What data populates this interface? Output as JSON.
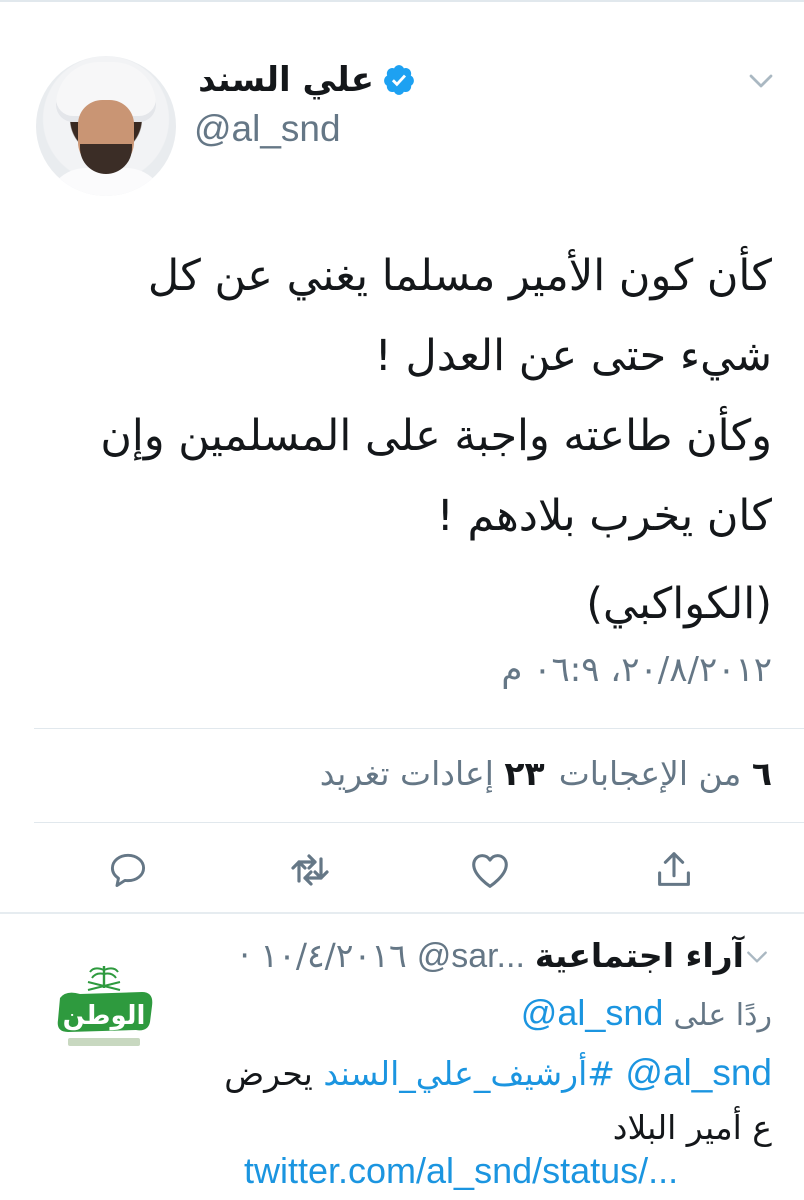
{
  "tweet": {
    "author_name": "علي السند",
    "handle": "@al_snd",
    "text_lines": [
      "كأن كون الأمير مسلما يغني عن كل",
      "شيء حتى عن العدل !",
      "وكأن طاعته واجبة على المسلمين وإن",
      "كان يخرب بلادهم !"
    ],
    "signature": "(الكواكبي)",
    "timestamp": "٢٠/٨/٢٠١٢، ٠٦:٩ م",
    "stats": {
      "likes_count": "٦",
      "likes_label": "من الإعجابات",
      "retweets_count": "٢٣",
      "retweets_label": "إعادات تغريد"
    }
  },
  "actions": {
    "reply_icon": "reply-icon",
    "retweet_icon": "retweet-icon",
    "like_icon": "heart-icon",
    "share_icon": "share-icon"
  },
  "reply": {
    "author_name": "آراء اجتماعية",
    "handle": "@sar...",
    "date": "١٠/٤/٢٠١٦ ·",
    "replying_label": "ردًا على",
    "replying_to": "@al_snd",
    "mention": "@al_snd",
    "hashtag": "#أرشيف_علي_السند",
    "body_tail": "يحرض",
    "body_line2": "ع أمير البلاد",
    "url": "twitter.com/al_snd/status/...",
    "logo_text": "الوطن"
  },
  "colors": {
    "text": "#14171a",
    "secondary": "#657786",
    "link": "#1b95e0",
    "verified": "#1da1f2",
    "logo_green": "#2e9a3e"
  }
}
